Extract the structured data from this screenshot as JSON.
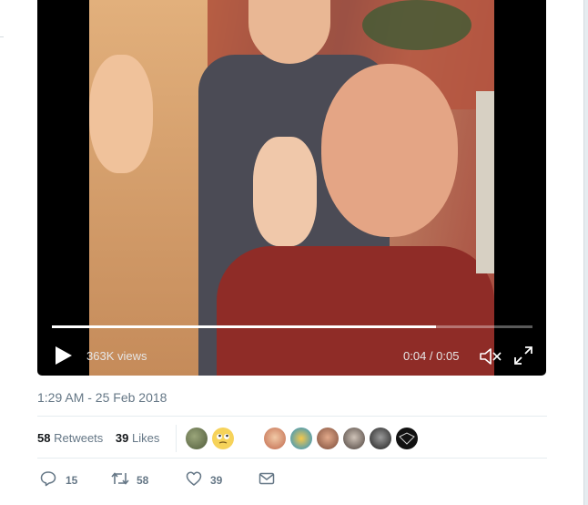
{
  "video": {
    "views_label": "363K views",
    "time_label": "0:04 / 0:05",
    "progress": 0.8
  },
  "tweet": {
    "timestamp": "1:29 AM - 25 Feb 2018"
  },
  "stats": {
    "retweets_count": "58",
    "retweets_label": "Retweets",
    "likes_count": "39",
    "likes_label": "Likes"
  },
  "actions": {
    "reply_count": "15",
    "retweet_count": "58",
    "like_count": "39"
  },
  "icons": {
    "play": "play-icon",
    "mute": "muted-speaker-icon",
    "fullscreen": "fullscreen-icon",
    "reply": "reply-icon",
    "retweet": "retweet-icon",
    "like": "heart-icon",
    "dm": "envelope-icon"
  }
}
